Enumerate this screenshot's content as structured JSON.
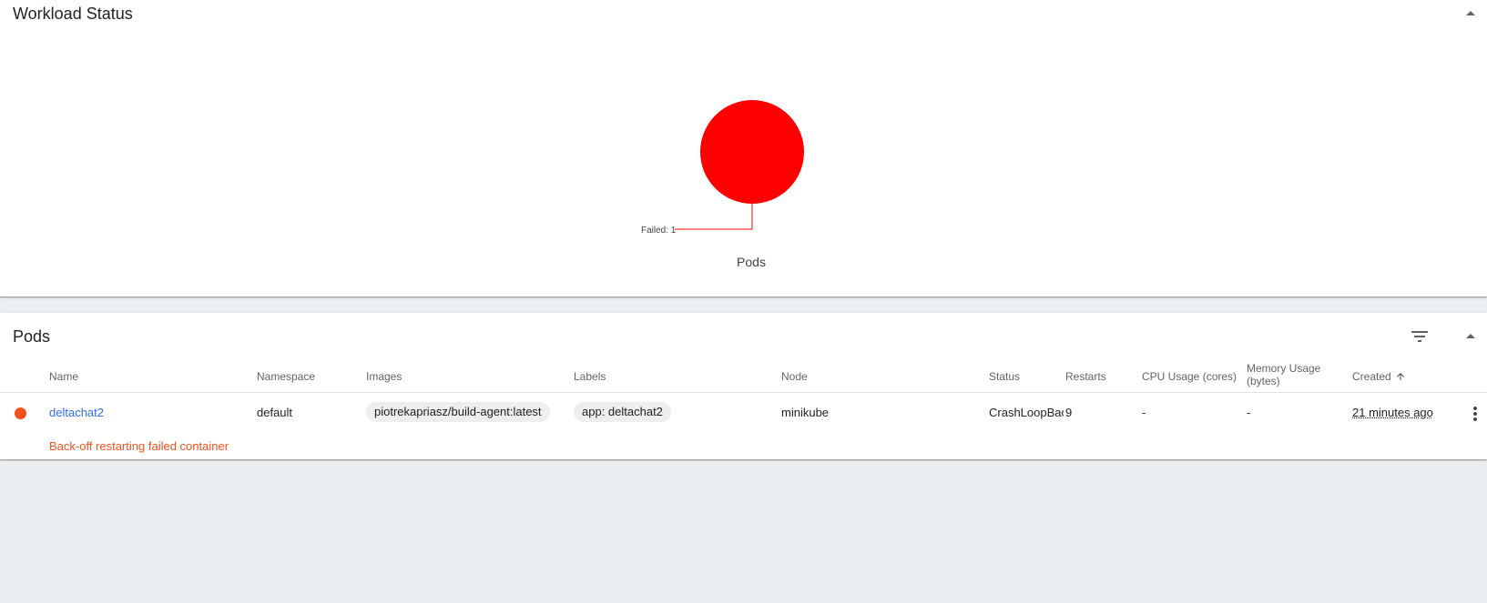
{
  "workload_status": {
    "title": "Workload Status",
    "chart_caption": "Pods",
    "collapse_icon": "chevron-up-icon"
  },
  "chart_data": {
    "type": "pie",
    "title": "",
    "slices": [
      {
        "label": "Failed",
        "value": 1,
        "color": "#ff0000"
      }
    ],
    "callout_label": "Failed: 1"
  },
  "pods": {
    "title": "Pods",
    "filter_icon": "filter-list-icon",
    "collapse_icon": "chevron-up-icon",
    "columns": {
      "name": "Name",
      "namespace": "Namespace",
      "images": "Images",
      "labels": "Labels",
      "node": "Node",
      "status": "Status",
      "restarts": "Restarts",
      "cpu": "CPU Usage (cores)",
      "memory_line1": "Memory Usage",
      "memory_line2": "(bytes)",
      "created": "Created",
      "sort_icon": "arrow-upward-icon"
    },
    "rows": [
      {
        "status_color": "#f4511e",
        "name": "deltachat2",
        "namespace": "default",
        "image": "piotrekapriasz/build-agent:latest",
        "label": "app: deltachat2",
        "node": "minikube",
        "status": "CrashLoopBackOff",
        "restarts": "9",
        "cpu": "-",
        "memory": "-",
        "created": "21 minutes ago",
        "message": "Back-off restarting failed container",
        "menu_icon": "more-vert-icon"
      }
    ]
  }
}
